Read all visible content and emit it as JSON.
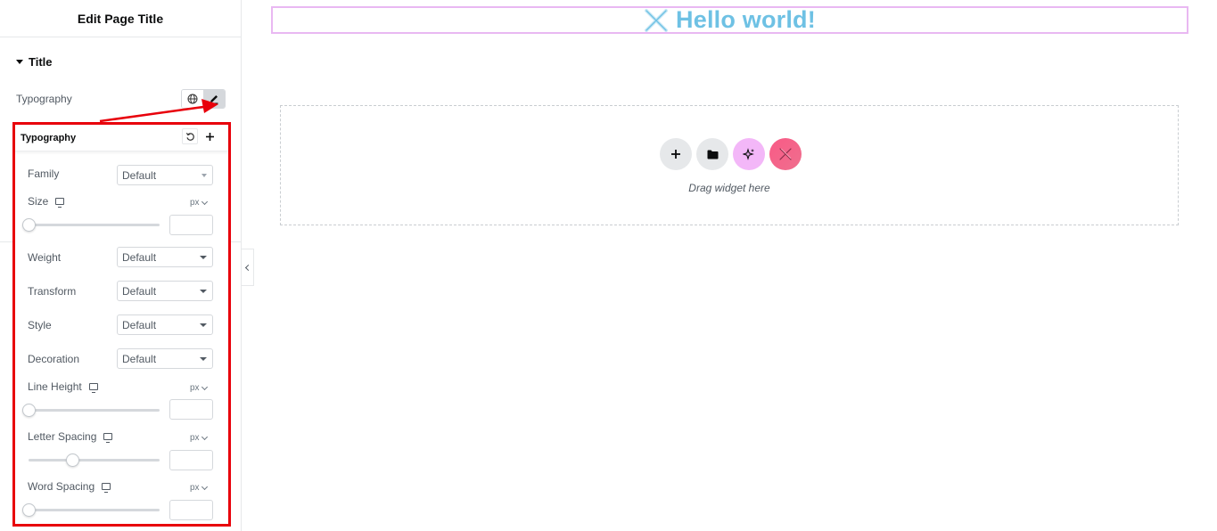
{
  "panel": {
    "header_title": "Edit Page Title",
    "section_title": "Title",
    "typography_label": "Typography",
    "icons": {
      "global": "globe-icon",
      "edit": "pencil-icon"
    }
  },
  "popover": {
    "title": "Typography",
    "icons": {
      "reset": "reset-icon",
      "add": "plus-icon"
    },
    "family": {
      "label": "Family",
      "value": "Default"
    },
    "size": {
      "label": "Size",
      "unit": "px",
      "slider_percent": 0,
      "value": ""
    },
    "weight": {
      "label": "Weight",
      "value": "Default"
    },
    "transform": {
      "label": "Transform",
      "value": "Default"
    },
    "style": {
      "label": "Style",
      "value": "Default"
    },
    "decoration": {
      "label": "Decoration",
      "value": "Default"
    },
    "line_height": {
      "label": "Line Height",
      "unit": "px",
      "slider_percent": 0,
      "value": ""
    },
    "letter_spacing": {
      "label": "Letter Spacing",
      "unit": "px",
      "slider_percent": 33,
      "value": ""
    },
    "word_spacing": {
      "label": "Word Spacing",
      "unit": "px",
      "slider_percent": 0,
      "value": ""
    }
  },
  "canvas": {
    "page_title": "Hello world!",
    "drop_text": "Drag widget here",
    "drop_buttons": [
      "add-section",
      "add-template",
      "ai-assistant",
      "elementskit-library"
    ]
  },
  "colors": {
    "title": "#6ec1e4",
    "highlight": "#e8000b",
    "title_box_border": "#e9b8f2",
    "ai_button": "#f3b7f8",
    "ekit_button": "#f95a86"
  }
}
